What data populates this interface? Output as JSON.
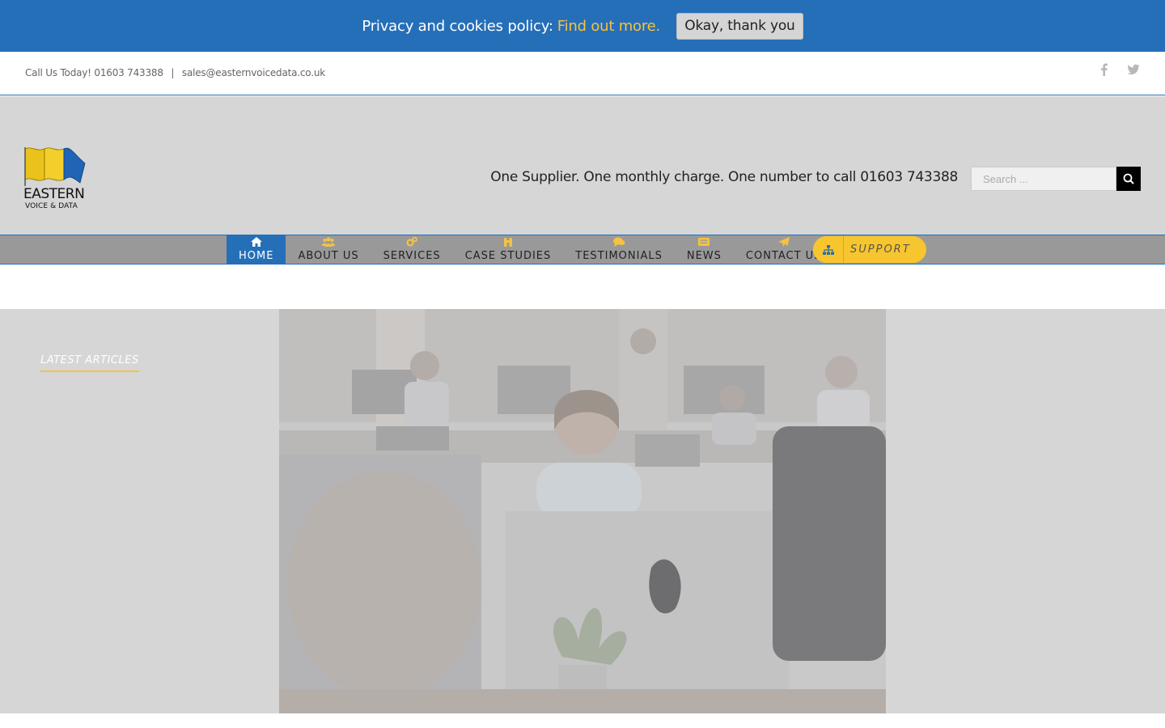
{
  "cookie": {
    "text": "Privacy and cookies policy:",
    "link": "Find out more",
    "dot": ".",
    "button": "Okay, thank you"
  },
  "topbar": {
    "phone": "Call Us Today! 01603 743388",
    "separator": "|",
    "email": "sales@easternvoicedata.co.uk",
    "social": [
      "facebook-icon",
      "twitter-icon"
    ]
  },
  "header": {
    "logo_title": "EASTERN",
    "logo_subtitle": "VOICE & DATA",
    "tagline": "One Supplier. One monthly charge. One number to call 01603 743388",
    "search_placeholder": "Search ..."
  },
  "nav": {
    "items": [
      {
        "label": "HOME",
        "icon": "home-icon",
        "active": true
      },
      {
        "label": "ABOUT US",
        "icon": "users-icon",
        "active": false
      },
      {
        "label": "SERVICES",
        "icon": "cogs-icon",
        "active": false
      },
      {
        "label": "CASE STUDIES",
        "icon": "binoculars-icon",
        "active": false
      },
      {
        "label": "TESTIMONIALS",
        "icon": "chat-icon",
        "active": false
      },
      {
        "label": "NEWS",
        "icon": "news-icon",
        "active": false
      },
      {
        "label": "CONTACT US",
        "icon": "paper-plane-icon",
        "active": false
      }
    ],
    "support_label": "SUPPORT"
  },
  "main": {
    "latest_title": "LATEST ARTICLES"
  },
  "colors": {
    "brand_blue": "#256fb8",
    "accent_yellow": "#f7c52e",
    "header_gray": "#d6d6d6",
    "nav_gray": "#999999"
  }
}
